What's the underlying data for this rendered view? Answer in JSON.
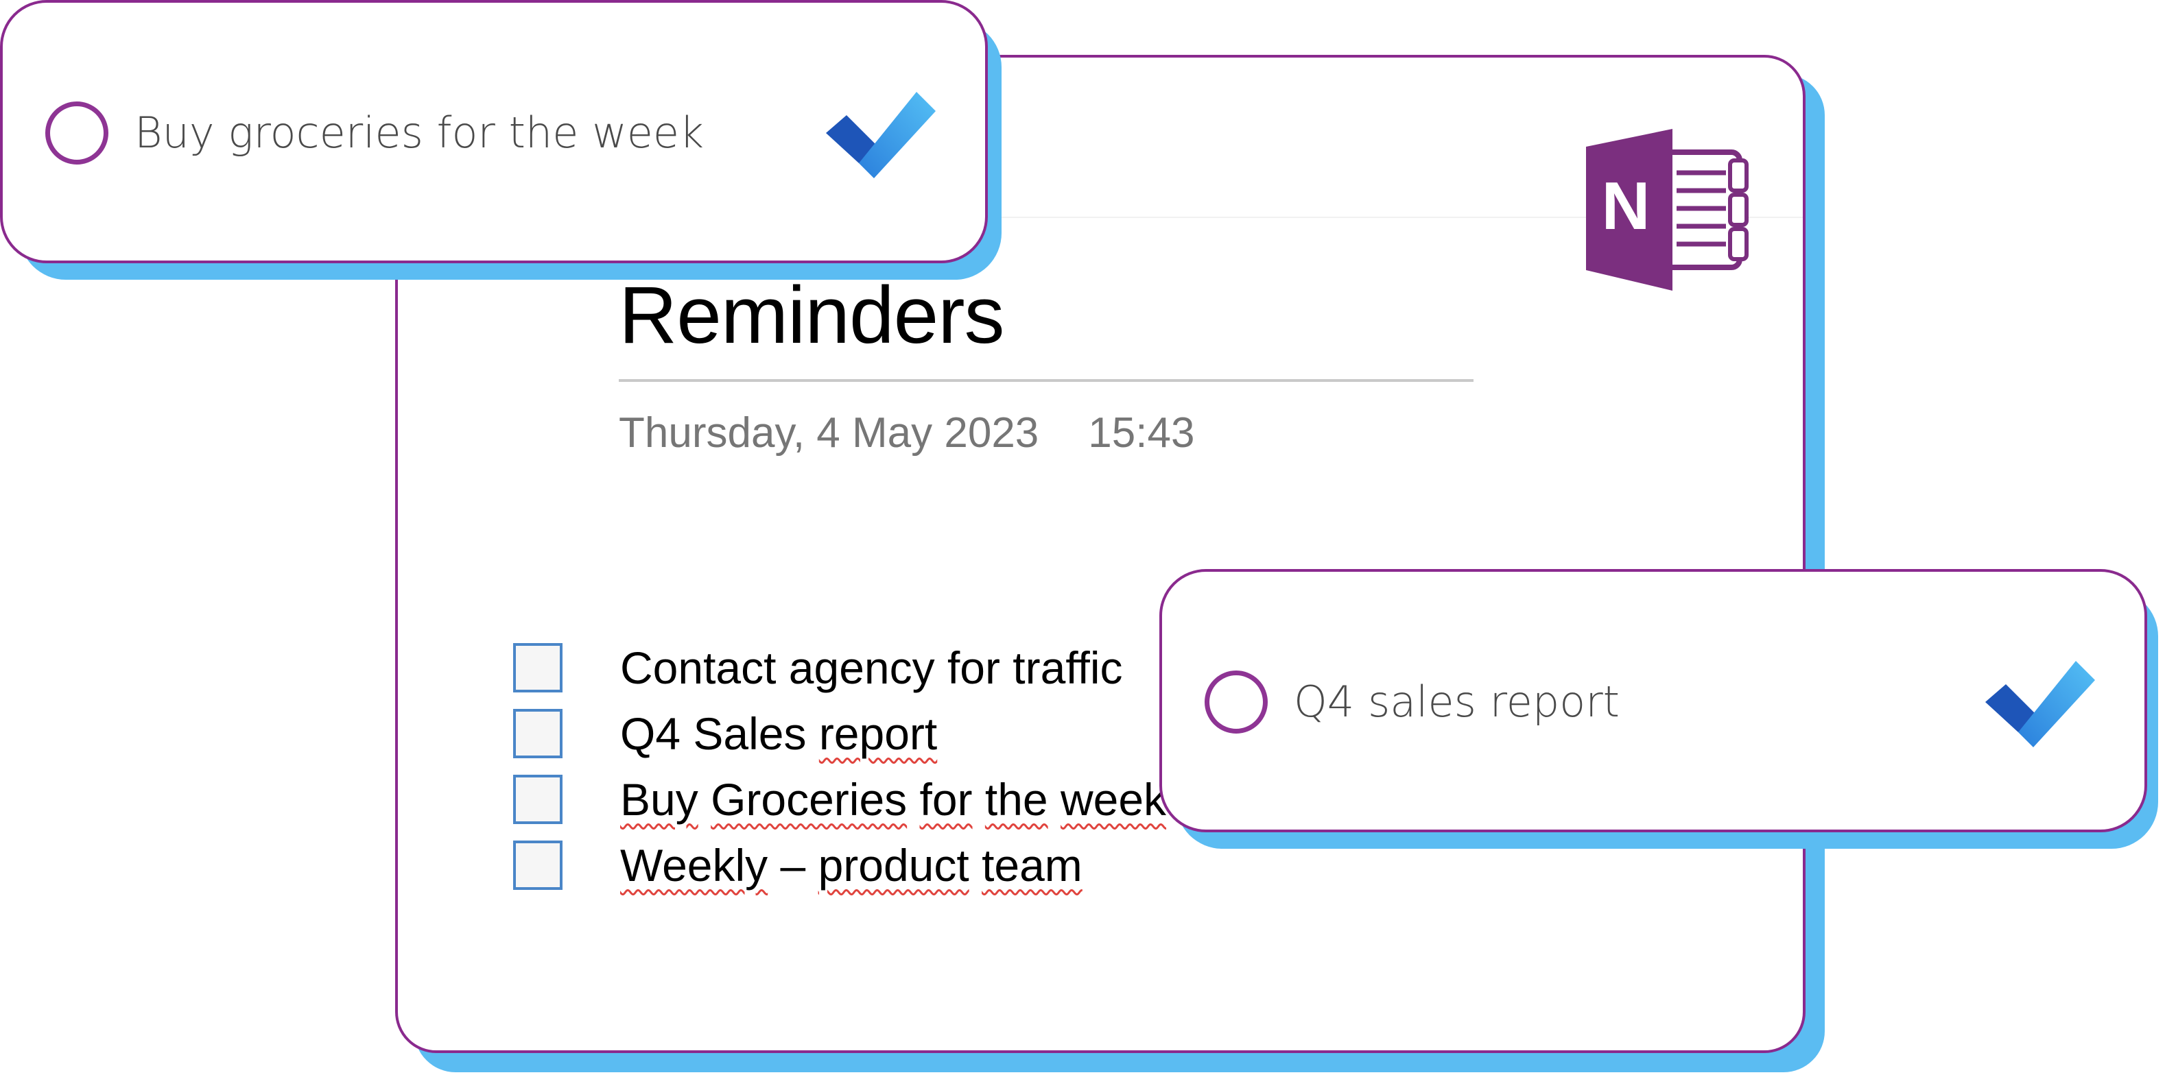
{
  "onenote_page": {
    "app_icon": "onenote-icon",
    "logo_letter": "N",
    "title": "Reminders",
    "date": "Thursday, 4 May 2023",
    "time": "15:43",
    "todos": [
      {
        "parts": [
          {
            "t": "Contact agency for traffic",
            "sq": false
          }
        ]
      },
      {
        "parts": [
          {
            "t": "Q4 Sales ",
            "sq": false
          },
          {
            "t": "report",
            "sq": true
          }
        ]
      },
      {
        "parts": [
          {
            "t": "Buy",
            "sq": true
          },
          {
            "t": " ",
            "sq": false
          },
          {
            "t": "Groceries",
            "sq": true
          },
          {
            "t": " ",
            "sq": false
          },
          {
            "t": "for",
            "sq": true
          },
          {
            "t": " ",
            "sq": false
          },
          {
            "t": "the",
            "sq": true
          },
          {
            "t": " ",
            "sq": false
          },
          {
            "t": "week",
            "sq": true
          }
        ]
      },
      {
        "parts": [
          {
            "t": "Weekly",
            "sq": true
          },
          {
            "t": " – ",
            "sq": false
          },
          {
            "t": "product",
            "sq": true
          },
          {
            "t": " ",
            "sq": false
          },
          {
            "t": "team",
            "sq": true
          }
        ]
      }
    ]
  },
  "task_cards": [
    {
      "label": "Buy groceries for the week",
      "icon": "microsoft-todo-check-icon"
    },
    {
      "label": "Q4 sales report",
      "icon": "microsoft-todo-check-icon"
    }
  ],
  "colors": {
    "accent_purple": "#8a2a8e",
    "onenote_purple": "#7b2f7f",
    "shadow_blue": "#5bbcf2",
    "checkbox_blue": "#4a86c8",
    "spellcheck_red": "#e0443e",
    "todo_blue_dark": "#1e55b8",
    "todo_blue_light": "#3fa3ee"
  }
}
